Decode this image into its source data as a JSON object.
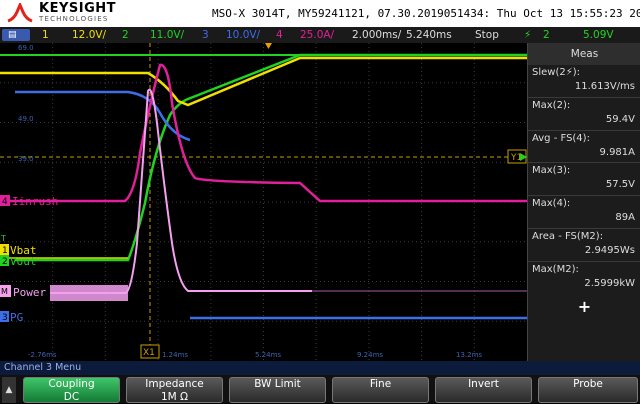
{
  "header": {
    "brand": "KEYSIGHT",
    "brand_sub": "TECHNOLOGIES",
    "instrument_info": "MSO-X 3014T, MY59241121, 07.30.2019051434: Thu Oct 13 15:55:23 2022"
  },
  "status": {
    "ch1_num": "1",
    "ch1_scale": "12.0V/",
    "ch2_num": "2",
    "ch2_scale": "11.0V/",
    "ch3_num": "3",
    "ch3_scale": "10.0V/",
    "ch4_num": "4",
    "ch4_scale": "25.0A/",
    "time_scale": "2.000ms/",
    "time_delay": "5.240ms",
    "run_state": "Stop",
    "trigger_source": "2",
    "trigger_level": "5.09V"
  },
  "waveform": {
    "labels": {
      "inrush": "Iinrush",
      "vbat": "Vbat",
      "vout": "Vout",
      "power": "Power",
      "pg": "PG",
      "cursor_x1": "X1",
      "cursor_y1": "Y1",
      "marker_ch4": "4",
      "marker_t": "T",
      "marker_1": "1",
      "marker_2": "2",
      "marker_m": "M",
      "marker_3": "3"
    },
    "y_ticks": [
      "69.0",
      "49.0",
      "39.0"
    ],
    "x_ticks": [
      "-2.76ms",
      "1.24ms",
      "5.24ms",
      "9.24ms",
      "13.2ms"
    ]
  },
  "measurements": {
    "title": "Meas",
    "items": [
      {
        "label": "Slew(2⚡):",
        "value": "11.613V/ms"
      },
      {
        "label": "Max(2):",
        "value": "59.4V"
      },
      {
        "label": "Avg - FS(4):",
        "value": "9.981A"
      },
      {
        "label": "Max(3):",
        "value": "57.5V"
      },
      {
        "label": "Max(4):",
        "value": "89A"
      },
      {
        "label": "Area - FS(M2):",
        "value": "2.9495Ws"
      },
      {
        "label": "Max(M2):",
        "value": "2.5999kW"
      }
    ],
    "add_symbol": "+"
  },
  "menu": {
    "title": "Channel 3 Menu",
    "back_symbol": "▲",
    "softkeys": [
      {
        "label": "Coupling",
        "value": "DC"
      },
      {
        "label": "Impedance",
        "value": "1M Ω"
      },
      {
        "label": "BW Limit",
        "value": ""
      },
      {
        "label": "Fine",
        "value": ""
      },
      {
        "label": "Invert",
        "value": ""
      },
      {
        "label": "Probe",
        "value": ""
      }
    ]
  },
  "colors": {
    "ch1": "#f0e000",
    "ch2": "#21d321",
    "ch3": "#3c6ee8",
    "ch4": "#e0209a",
    "math": "#f3a0ee"
  },
  "icons": [
    "keysight-logo-icon",
    "trigger-edge-icon",
    "plus-icon",
    "back-arrow-icon"
  ]
}
